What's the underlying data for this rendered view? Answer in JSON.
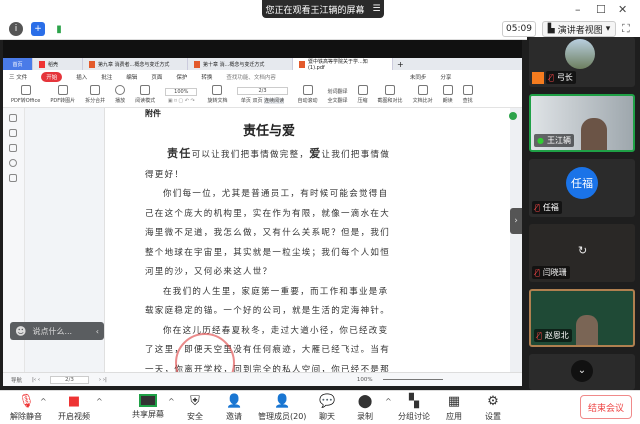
{
  "banner": {
    "text": "您正在观看王江辆的屏幕"
  },
  "topbar": {
    "timer": "05:09",
    "view_mode": "演讲者视图"
  },
  "wps": {
    "tabs": [
      "首页",
      "稻壳",
      "第九章 消费者...概念与变迁方式",
      "第十章 消...概念与变迁方式",
      "暨中铁高等学院关于学...知 (1).pdf"
    ],
    "menu": [
      "三 文件",
      "开始",
      "插入",
      "批注",
      "编辑",
      "页面",
      "保护",
      "转换",
      "查找功能、文档内容",
      "未同步",
      "分享"
    ],
    "tools": [
      "PDF转Office",
      "PDF转图片",
      "拆分合并",
      "播放",
      "阅读模式",
      "100%",
      "旋转文档",
      "2/3",
      "单页",
      "双页",
      "连续阅读",
      "自动滚动",
      "划词翻译",
      "全文翻译",
      "压缩",
      "截图和对比",
      "文档比对",
      "朗读",
      "查找"
    ],
    "status": {
      "nav": "导航",
      "page": "2/3",
      "zoom": "100%"
    }
  },
  "document": {
    "label": "附件",
    "title": "责任与爱",
    "intro_bold1": "责任",
    "intro_text1": "可以让我们把事情做完整，",
    "intro_bold2": "爱",
    "intro_text2": "让我们把事情做得更好！",
    "paragraphs": [
      "你们每一位，尤其是普通员工，有时候可能会觉得自己在这个庞大的机构里，实在作为有限，就像一滴水在大海里微不足道，我怎么做，又有什么关系呢？但是，我们整个地球在宇宙里，其实就是一粒尘埃；我们每个人如恒河里的沙，又何必来这人世？",
      "在我们的人生里，家庭第一重要，而工作和事业是承载家庭稳定的锚。一个好的公司，就是生活的定海神针。",
      "你在这儿历经春夏秋冬，走过大道小径，你已经改变了这里，即便天空里没有任何痕迹，大雁已经飞过。当有一天，你离开学校，回到完全的私人空间，你已经不是那个第一天来学校上班的"
    ]
  },
  "chat": {
    "placeholder": "说点什么..."
  },
  "participants": [
    {
      "name": "弓长",
      "muted": true,
      "avatar": "photo"
    },
    {
      "name": "王江辆",
      "muted": false,
      "avatar": "video"
    },
    {
      "name": "任福",
      "muted": true,
      "avatar": "任福"
    },
    {
      "name": "闫晓珊",
      "muted": true,
      "avatar": "loading"
    },
    {
      "name": "赵恩北",
      "muted": true,
      "avatar": "video"
    }
  ],
  "toolbar": {
    "mute": "解除静音",
    "video": "开启视频",
    "share": "共享屏幕",
    "security": "安全",
    "invite": "邀请",
    "members": "管理成员(20)",
    "chat": "聊天",
    "record": "录制",
    "breakout": "分组讨论",
    "apps": "应用",
    "settings": "设置",
    "end": "结束会议"
  },
  "colors": {
    "accent": "#1a73e8",
    "end": "#e44444",
    "active_speaker": "#1fa046"
  }
}
